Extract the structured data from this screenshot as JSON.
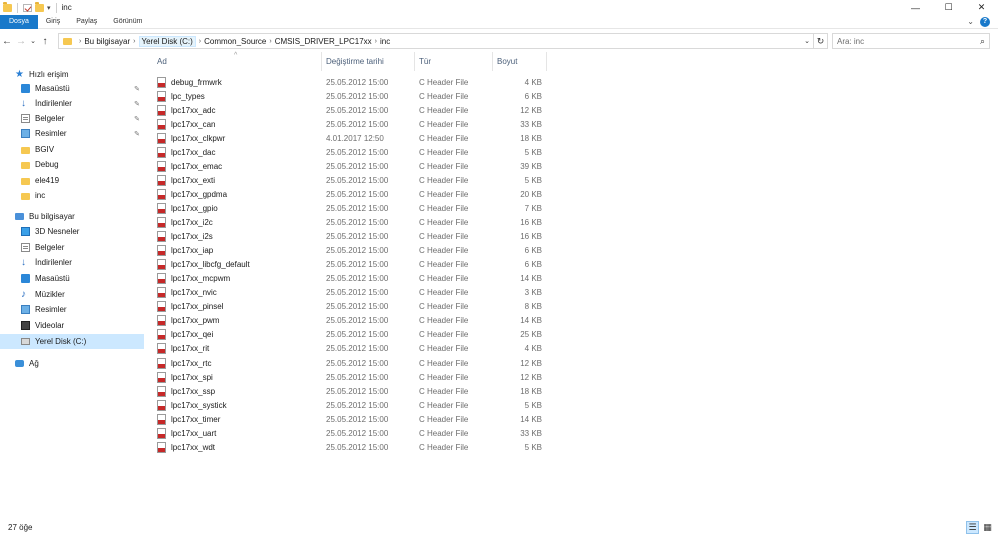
{
  "window": {
    "title": "inc",
    "controls": {
      "minimize": "—",
      "maximize": "☐",
      "close": "✕"
    }
  },
  "ribbon": {
    "tabs": [
      "Dosya",
      "Giriş",
      "Paylaş",
      "Görünüm"
    ],
    "file_tab_color": "#1979ca"
  },
  "address": {
    "crumbs": [
      "Bu bilgisayar",
      "Yerel Disk (C:)",
      "Common_Source",
      "CMSIS_DRIVER_LPC17xx",
      "inc"
    ],
    "search_placeholder": "Ara: inc"
  },
  "sidebar": {
    "items": [
      {
        "label": "Hızlı erişim",
        "icon": "quick-access-star-icon",
        "pinned": false
      },
      {
        "label": "Masaüstü",
        "icon": "desktop-icon",
        "pinned": true
      },
      {
        "label": "İndirilenler",
        "icon": "download-arrow-icon",
        "pinned": true
      },
      {
        "label": "Belgeler",
        "icon": "documents-icon",
        "pinned": true
      },
      {
        "label": "Resimler",
        "icon": "pictures-icon",
        "pinned": true
      },
      {
        "label": "BGIV",
        "icon": "folder-icon",
        "pinned": false
      },
      {
        "label": "Debug",
        "icon": "folder-icon",
        "pinned": false
      },
      {
        "label": "ele419",
        "icon": "folder-icon",
        "pinned": false
      },
      {
        "label": "inc",
        "icon": "folder-icon",
        "pinned": false
      },
      {
        "label": "Bu bilgisayar",
        "icon": "this-pc-icon",
        "pinned": false
      },
      {
        "label": "3D Nesneler",
        "icon": "3d-objects-icon",
        "pinned": false
      },
      {
        "label": "Belgeler",
        "icon": "documents-icon",
        "pinned": false
      },
      {
        "label": "İndirilenler",
        "icon": "download-arrow-icon",
        "pinned": false
      },
      {
        "label": "Masaüstü",
        "icon": "desktop-icon",
        "pinned": false
      },
      {
        "label": "Müzikler",
        "icon": "music-note-icon",
        "pinned": false
      },
      {
        "label": "Resimler",
        "icon": "pictures-icon",
        "pinned": false
      },
      {
        "label": "Videolar",
        "icon": "videos-icon",
        "pinned": false
      },
      {
        "label": "Yerel Disk (C:)",
        "icon": "local-disk-icon",
        "pinned": false,
        "selected": true
      },
      {
        "label": "Ağ",
        "icon": "network-icon",
        "pinned": false
      }
    ]
  },
  "columns": [
    "Ad",
    "Değiştirme tarihi",
    "Tür",
    "Boyut"
  ],
  "files": [
    {
      "name": "debug_frmwrk",
      "date": "25.05.2012 15:00",
      "type": "C Header File",
      "size": "4 KB"
    },
    {
      "name": "lpc_types",
      "date": "25.05.2012 15:00",
      "type": "C Header File",
      "size": "6 KB"
    },
    {
      "name": "lpc17xx_adc",
      "date": "25.05.2012 15:00",
      "type": "C Header File",
      "size": "12 KB"
    },
    {
      "name": "lpc17xx_can",
      "date": "25.05.2012 15:00",
      "type": "C Header File",
      "size": "33 KB"
    },
    {
      "name": "lpc17xx_clkpwr",
      "date": "4.01.2017 12:50",
      "type": "C Header File",
      "size": "18 KB"
    },
    {
      "name": "lpc17xx_dac",
      "date": "25.05.2012 15:00",
      "type": "C Header File",
      "size": "5 KB"
    },
    {
      "name": "lpc17xx_emac",
      "date": "25.05.2012 15:00",
      "type": "C Header File",
      "size": "39 KB"
    },
    {
      "name": "lpc17xx_exti",
      "date": "25.05.2012 15:00",
      "type": "C Header File",
      "size": "5 KB"
    },
    {
      "name": "lpc17xx_gpdma",
      "date": "25.05.2012 15:00",
      "type": "C Header File",
      "size": "20 KB"
    },
    {
      "name": "lpc17xx_gpio",
      "date": "25.05.2012 15:00",
      "type": "C Header File",
      "size": "7 KB"
    },
    {
      "name": "lpc17xx_i2c",
      "date": "25.05.2012 15:00",
      "type": "C Header File",
      "size": "16 KB"
    },
    {
      "name": "lpc17xx_i2s",
      "date": "25.05.2012 15:00",
      "type": "C Header File",
      "size": "16 KB"
    },
    {
      "name": "lpc17xx_iap",
      "date": "25.05.2012 15:00",
      "type": "C Header File",
      "size": "6 KB"
    },
    {
      "name": "lpc17xx_libcfg_default",
      "date": "25.05.2012 15:00",
      "type": "C Header File",
      "size": "6 KB"
    },
    {
      "name": "lpc17xx_mcpwm",
      "date": "25.05.2012 15:00",
      "type": "C Header File",
      "size": "14 KB"
    },
    {
      "name": "lpc17xx_nvic",
      "date": "25.05.2012 15:00",
      "type": "C Header File",
      "size": "3 KB"
    },
    {
      "name": "lpc17xx_pinsel",
      "date": "25.05.2012 15:00",
      "type": "C Header File",
      "size": "8 KB"
    },
    {
      "name": "lpc17xx_pwm",
      "date": "25.05.2012 15:00",
      "type": "C Header File",
      "size": "14 KB"
    },
    {
      "name": "lpc17xx_qei",
      "date": "25.05.2012 15:00",
      "type": "C Header File",
      "size": "25 KB"
    },
    {
      "name": "lpc17xx_rit",
      "date": "25.05.2012 15:00",
      "type": "C Header File",
      "size": "4 KB"
    },
    {
      "name": "lpc17xx_rtc",
      "date": "25.05.2012 15:00",
      "type": "C Header File",
      "size": "12 KB"
    },
    {
      "name": "lpc17xx_spi",
      "date": "25.05.2012 15:00",
      "type": "C Header File",
      "size": "12 KB"
    },
    {
      "name": "lpc17xx_ssp",
      "date": "25.05.2012 15:00",
      "type": "C Header File",
      "size": "18 KB"
    },
    {
      "name": "lpc17xx_systick",
      "date": "25.05.2012 15:00",
      "type": "C Header File",
      "size": "5 KB"
    },
    {
      "name": "lpc17xx_timer",
      "date": "25.05.2012 15:00",
      "type": "C Header File",
      "size": "14 KB"
    },
    {
      "name": "lpc17xx_uart",
      "date": "25.05.2012 15:00",
      "type": "C Header File",
      "size": "33 KB"
    },
    {
      "name": "lpc17xx_wdt",
      "date": "25.05.2012 15:00",
      "type": "C Header File",
      "size": "5 KB"
    }
  ],
  "status": {
    "item_count": "27 öğe"
  },
  "colors": {
    "accent": "#1979ca",
    "selection": "#cce8ff",
    "file_icon_red": "#c62828",
    "folder_yellow": "#f6c851"
  }
}
